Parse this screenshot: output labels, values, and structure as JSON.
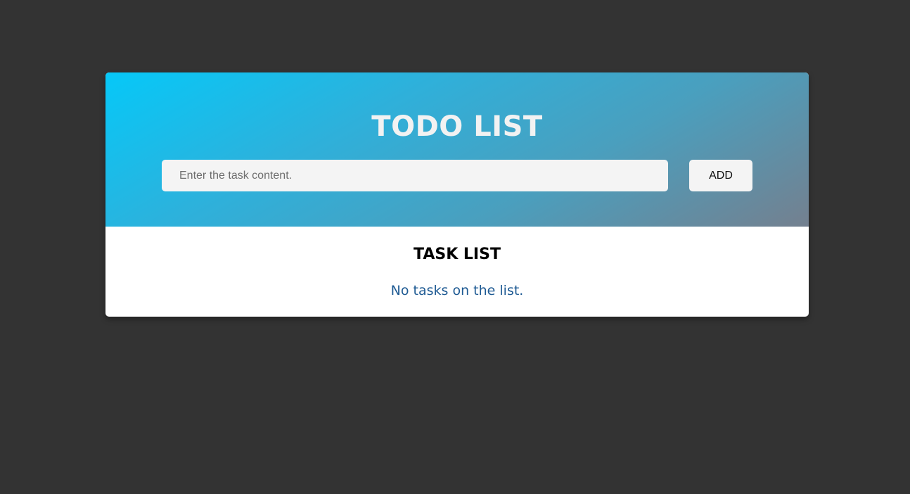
{
  "header": {
    "title": "TODO LIST",
    "input_placeholder": "Enter the task content.",
    "input_value": "",
    "add_label": "ADD"
  },
  "task_list": {
    "title": "TASK LIST",
    "empty_message": "No tasks on the list.",
    "items": []
  },
  "colors": {
    "page_background": "#333333",
    "header_gradient_start": "#06c8f8",
    "header_gradient_end": "#74808f",
    "empty_message": "#1e5a93"
  }
}
